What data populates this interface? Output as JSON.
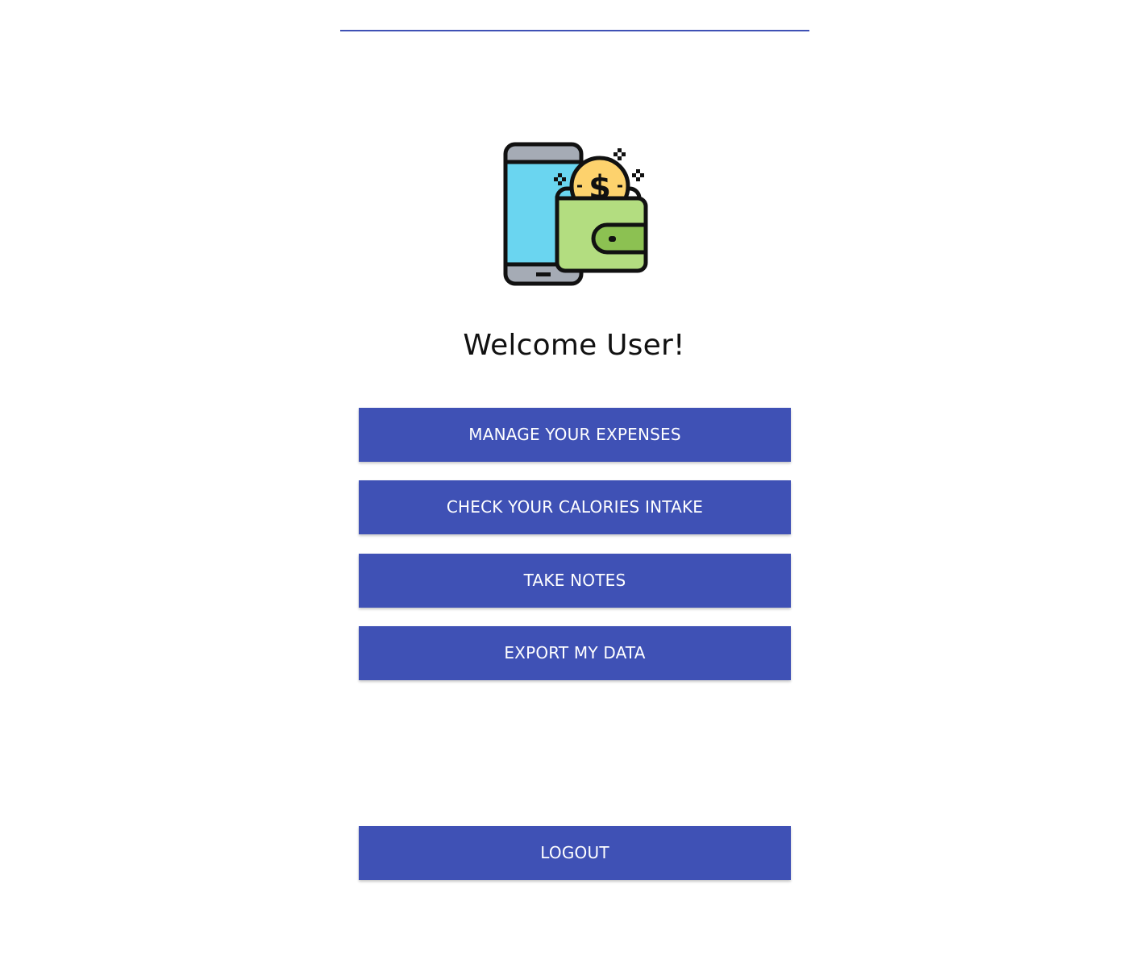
{
  "header": {
    "welcome_text": "Welcome User!"
  },
  "logo": {
    "icon": "phone-wallet-dollar-icon",
    "coin_symbol": "$"
  },
  "menu": {
    "manage_expenses_label": "MANAGE YOUR EXPENSES",
    "check_calories_label": "CHECK YOUR CALORIES INTAKE",
    "take_notes_label": "TAKE NOTES",
    "export_data_label": "EXPORT MY DATA"
  },
  "footer": {
    "logout_label": "LOGOUT"
  },
  "colors": {
    "accent": "#3f51b5",
    "button_text": "#ffffff",
    "phone_screen": "#6ad5f0",
    "phone_body": "#a5abb5",
    "wallet": "#b3dd80",
    "wallet_clasp": "#8cc152",
    "coin": "#fdd26d"
  }
}
